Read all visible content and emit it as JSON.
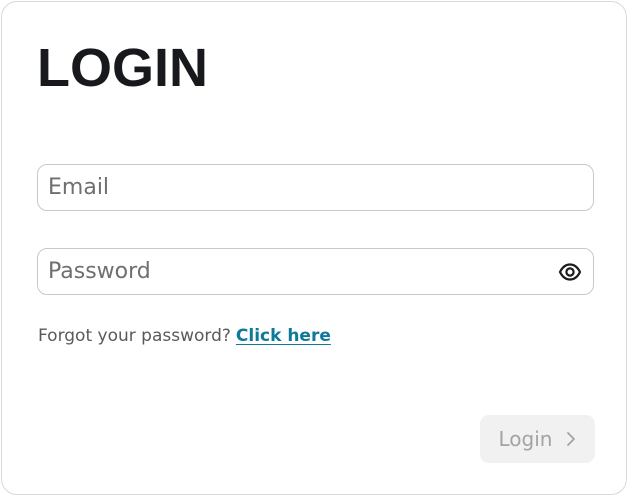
{
  "header": {
    "title": "LOGIN"
  },
  "form": {
    "email_placeholder": "Email",
    "email_value": "",
    "password_placeholder": "Password",
    "password_value": "",
    "forgot_text": "Forgot your password?",
    "forgot_link": "Click here",
    "submit_label": "Login",
    "submit_disabled": true
  },
  "icons": {
    "password_toggle": "eye-icon",
    "submit_arrow": "chevron-right-icon"
  },
  "colors": {
    "title": "#17191c",
    "link": "#0f7a98",
    "field_border": "#c9c9c9",
    "button_bg": "#f1f1f1",
    "button_text": "#a3a3a3"
  }
}
